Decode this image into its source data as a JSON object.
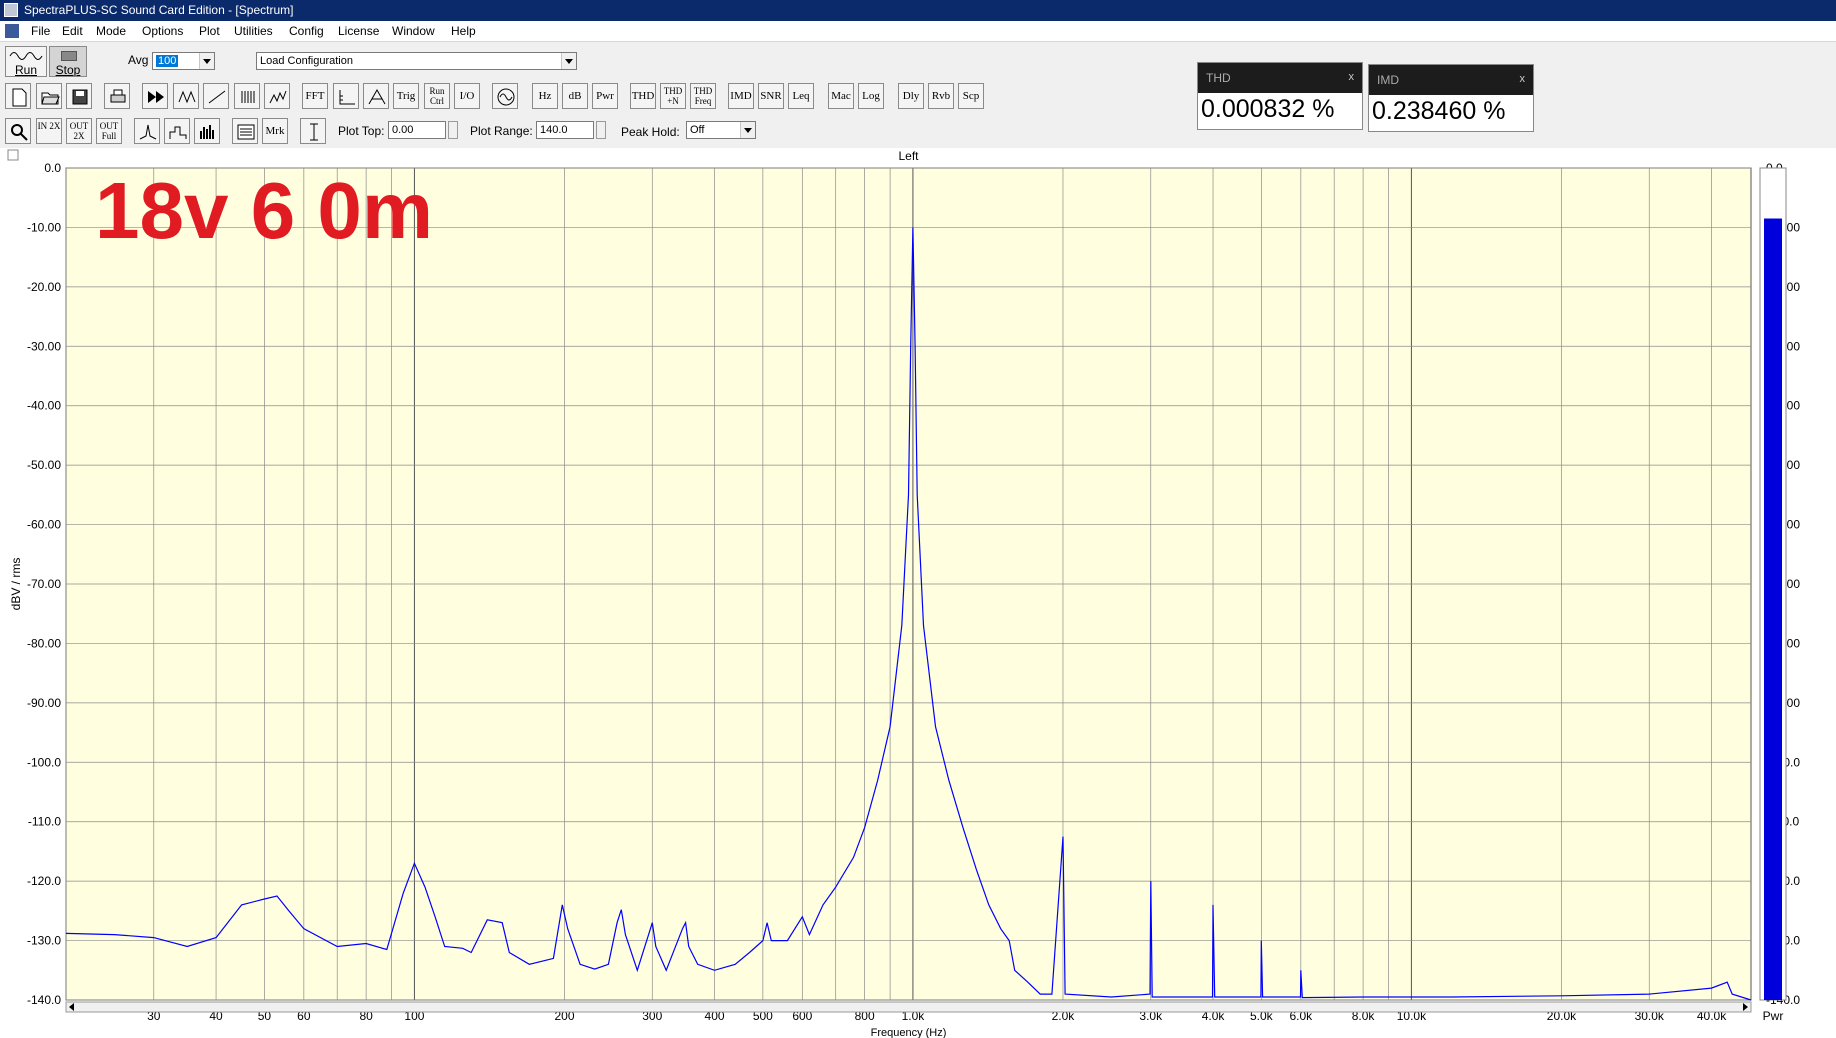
{
  "window": {
    "title": "SpectraPLUS-SC Sound Card Edition - [Spectrum]"
  },
  "menu": [
    "File",
    "Edit",
    "Mode",
    "Options",
    "Plot",
    "Utilities",
    "Config",
    "License",
    "Window",
    "Help"
  ],
  "toolbar1": {
    "run_label": "Run",
    "stop_label": "Stop",
    "avg_label": "Avg",
    "avg_value": "100",
    "config_value": "Load Configuration"
  },
  "toolbar2": {
    "buttons": [
      {
        "name": "new-file-icon"
      },
      {
        "name": "open-folder-icon"
      },
      {
        "name": "save-icon"
      },
      {
        "name": "print-icon"
      },
      {
        "name": "fast-forward-icon"
      },
      {
        "name": "record-icon"
      },
      {
        "name": "waveform-icon"
      },
      {
        "name": "bars-icon"
      },
      {
        "name": "spectrum-3d-icon"
      },
      {
        "label": "FFT"
      },
      {
        "name": "scale-icon"
      },
      {
        "name": "trigger-icon"
      },
      {
        "label": "Trig"
      },
      {
        "label": "Run Ctrl"
      },
      {
        "label": "I/O"
      },
      {
        "name": "generator-icon"
      },
      {
        "label": "Hz"
      },
      {
        "label": "dB"
      },
      {
        "label": "Pwr"
      },
      {
        "label": "THD"
      },
      {
        "label": "THD +N"
      },
      {
        "label": "THD Freq"
      },
      {
        "label": "IMD"
      },
      {
        "label": "SNR"
      },
      {
        "label": "Leq"
      },
      {
        "label": "Mac"
      },
      {
        "label": "Log"
      },
      {
        "label": "Dly"
      },
      {
        "label": "Rvb"
      },
      {
        "label": "Scp"
      }
    ]
  },
  "toolbar3": {
    "zoom_buttons": [
      {
        "name": "zoom-icon"
      },
      {
        "label": "IN 2X"
      },
      {
        "label": "OUT 2X"
      },
      {
        "label": "OUT Full"
      }
    ],
    "plot_buttons": [
      {
        "name": "line-plot-icon"
      },
      {
        "name": "step-plot-icon"
      },
      {
        "name": "bar-plot-icon"
      },
      {
        "name": "list-icon"
      },
      {
        "label": "Mrk"
      },
      {
        "name": "cursor-icon"
      }
    ],
    "plot_top_label": "Plot Top:",
    "plot_top_value": "0.00",
    "plot_range_label": "Plot Range:",
    "plot_range_value": "140.0",
    "peak_hold_label": "Peak Hold:",
    "peak_hold_value": "Off"
  },
  "meters": [
    {
      "title": "THD",
      "value": "0.000832 %",
      "close": "x"
    },
    {
      "title": "IMD",
      "value": "0.238460 %",
      "close": "x"
    }
  ],
  "annotation": {
    "text": "18v 6 0m",
    "color": "#e11b22"
  },
  "colors": {
    "plot_bg": "#ffffdf",
    "trace": "#0000ff",
    "meter_bar": "#0000dd",
    "grid": "#8a8a8a"
  },
  "chart_data": {
    "type": "line",
    "title": "Left",
    "xlabel": "Frequency (Hz)",
    "ylabel": "dBV / rms",
    "x_scale": "log",
    "xlim": [
      20,
      48000
    ],
    "ylim": [
      -140,
      0
    ],
    "y_ticks": [
      "0.0",
      "-10.00",
      "-20.00",
      "-30.00",
      "-40.00",
      "-50.00",
      "-60.00",
      "-70.00",
      "-80.00",
      "-90.00",
      "-100.0",
      "-110.0",
      "-120.0",
      "-130.0",
      "-140.0"
    ],
    "x_ticks": [
      {
        "label": "30",
        "value": 30
      },
      {
        "label": "40",
        "value": 40
      },
      {
        "label": "50",
        "value": 50
      },
      {
        "label": "60",
        "value": 60
      },
      {
        "label": "80",
        "value": 80
      },
      {
        "label": "100",
        "value": 100
      },
      {
        "label": "200",
        "value": 200
      },
      {
        "label": "300",
        "value": 300
      },
      {
        "label": "400",
        "value": 400
      },
      {
        "label": "500",
        "value": 500
      },
      {
        "label": "600",
        "value": 600
      },
      {
        "label": "800",
        "value": 800
      },
      {
        "label": "1.0k",
        "value": 1000
      },
      {
        "label": "2.0k",
        "value": 2000
      },
      {
        "label": "3.0k",
        "value": 3000
      },
      {
        "label": "4.0k",
        "value": 4000
      },
      {
        "label": "5.0k",
        "value": 5000
      },
      {
        "label": "6.0k",
        "value": 6000
      },
      {
        "label": "8.0k",
        "value": 8000
      },
      {
        "label": "10.0k",
        "value": 10000
      },
      {
        "label": "20.0k",
        "value": 20000
      },
      {
        "label": "30.0k",
        "value": 30000
      },
      {
        "label": "40.0k",
        "value": 40000
      }
    ],
    "series": [
      {
        "points": [
          [
            20,
            -128.8
          ],
          [
            25,
            -129
          ],
          [
            30,
            -129.5
          ],
          [
            35,
            -131
          ],
          [
            40,
            -129.5
          ],
          [
            45,
            -124
          ],
          [
            50,
            -123
          ],
          [
            53,
            -122.5
          ],
          [
            56,
            -125
          ],
          [
            60,
            -128
          ],
          [
            70,
            -131
          ],
          [
            80,
            -130.5
          ],
          [
            88,
            -131.5
          ],
          [
            95,
            -122
          ],
          [
            100,
            -117
          ],
          [
            105,
            -121
          ],
          [
            110,
            -126
          ],
          [
            115,
            -131
          ],
          [
            125,
            -131.3
          ],
          [
            130,
            -132
          ],
          [
            140,
            -126.5
          ],
          [
            150,
            -127
          ],
          [
            155,
            -132
          ],
          [
            170,
            -134
          ],
          [
            190,
            -133
          ],
          [
            198,
            -124
          ],
          [
            203,
            -128
          ],
          [
            215,
            -134
          ],
          [
            230,
            -134.8
          ],
          [
            245,
            -134
          ],
          [
            255,
            -127
          ],
          [
            260,
            -124.8
          ],
          [
            265,
            -129
          ],
          [
            280,
            -135
          ],
          [
            295,
            -129
          ],
          [
            300,
            -127
          ],
          [
            305,
            -131
          ],
          [
            320,
            -135
          ],
          [
            345,
            -128
          ],
          [
            350,
            -127
          ],
          [
            355,
            -131
          ],
          [
            370,
            -134
          ],
          [
            400,
            -135
          ],
          [
            440,
            -134
          ],
          [
            470,
            -132
          ],
          [
            500,
            -130
          ],
          [
            510,
            -127
          ],
          [
            520,
            -130
          ],
          [
            560,
            -130
          ],
          [
            600,
            -126
          ],
          [
            620,
            -129
          ],
          [
            660,
            -124
          ],
          [
            700,
            -121
          ],
          [
            760,
            -116
          ],
          [
            800,
            -111
          ],
          [
            850,
            -103
          ],
          [
            900,
            -94
          ],
          [
            950,
            -77
          ],
          [
            980,
            -55
          ],
          [
            990,
            -30
          ],
          [
            1000,
            -10
          ],
          [
            1010,
            -30
          ],
          [
            1020,
            -55
          ],
          [
            1050,
            -77
          ],
          [
            1110,
            -94
          ],
          [
            1180,
            -103
          ],
          [
            1260,
            -111
          ],
          [
            1340,
            -118
          ],
          [
            1420,
            -124
          ],
          [
            1500,
            -128
          ],
          [
            1560,
            -130
          ],
          [
            1600,
            -135
          ],
          [
            1700,
            -137
          ],
          [
            1800,
            -139
          ],
          [
            1900,
            -139
          ],
          [
            2000,
            -112.5
          ],
          [
            2020,
            -139
          ],
          [
            2500,
            -139.5
          ],
          [
            2990,
            -139
          ],
          [
            3000,
            -120
          ],
          [
            3020,
            -139.5
          ],
          [
            3990,
            -139.5
          ],
          [
            4000,
            -124
          ],
          [
            4030,
            -139.5
          ],
          [
            4990,
            -139.5
          ],
          [
            5000,
            -130
          ],
          [
            5030,
            -139.5
          ],
          [
            5990,
            -139.5
          ],
          [
            6000,
            -135
          ],
          [
            6040,
            -139.6
          ],
          [
            8000,
            -139.5
          ],
          [
            12000,
            -139.5
          ],
          [
            20000,
            -139.3
          ],
          [
            30000,
            -139
          ],
          [
            40000,
            -138
          ],
          [
            43000,
            -137
          ],
          [
            44000,
            -139
          ],
          [
            48000,
            -140
          ]
        ]
      }
    ],
    "level_meter": {
      "label": "Pwr",
      "level_dbv": -8.5
    }
  }
}
